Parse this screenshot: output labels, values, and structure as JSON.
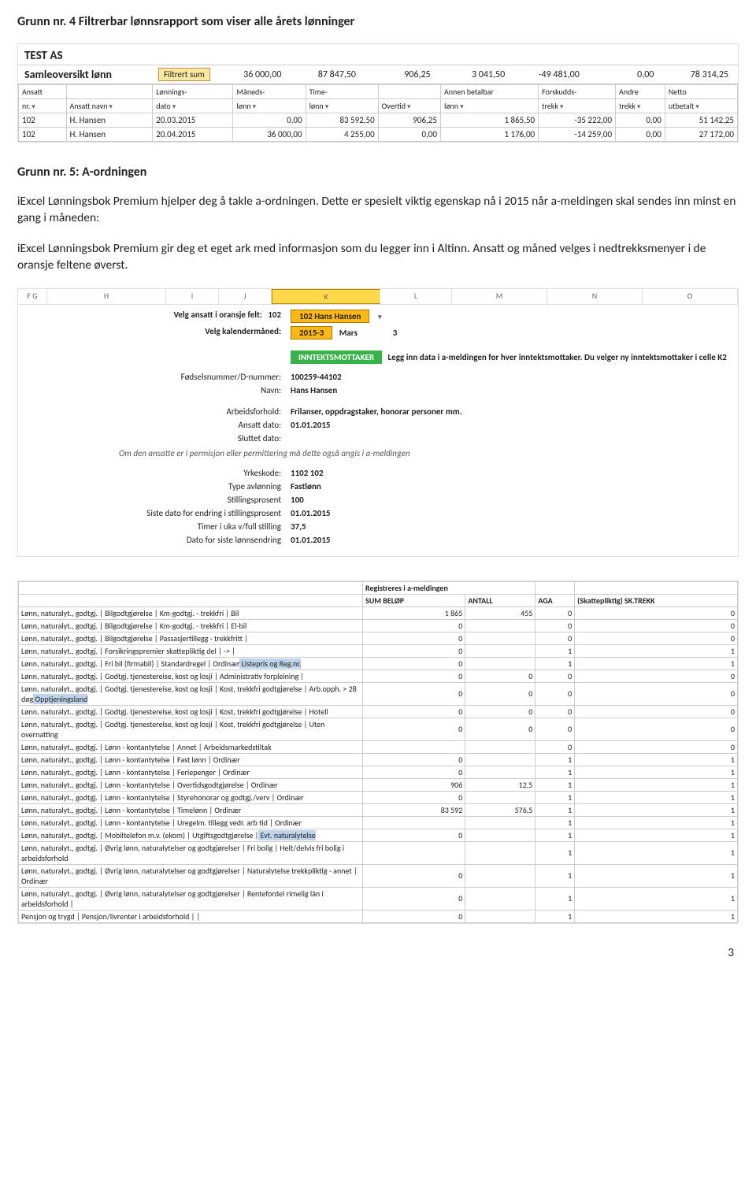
{
  "headings": {
    "title1": "Grunn nr. 4 Filtrerbar lønnsrapport som viser alle årets lønninger",
    "title2": "Grunn nr. 5: A-ordningen"
  },
  "prose": {
    "p1a": "iExcel Lønningsbok Premium hjelper deg å takle a-ordningen. Dette er spesielt viktig egenskap nå i 2015 når a-meldingen skal sendes inn minst en gang i måneden:",
    "p1b": "iExcel Lønningsbok Premium gir deg et eget ark med informasjon som du legger inn i Altinn. Ansatt og måned velges i nedtrekksmenyer i de oransje feltene øverst."
  },
  "block1": {
    "company": "TEST AS",
    "samle_label": "Samleoversikt lønn",
    "filtrert": "Filtrert sum",
    "sum": [
      "36 000,00",
      "87 847,50",
      "906,25",
      "3 041,50",
      "-49 481,00",
      "0,00",
      "78 314,25"
    ],
    "headers1": [
      "Ansatt",
      "",
      "Lønnings-",
      "Måneds-",
      "Time-",
      "",
      "Annen betalbar",
      "Forskudds-",
      "Andre",
      "Netto"
    ],
    "headers2": [
      "nr.",
      "Ansatt navn",
      "dato",
      "lønn",
      "lønn",
      "Overtid",
      "lønn",
      "trekk",
      "trekk",
      "utbetalt"
    ],
    "rows": [
      [
        "102",
        "H. Hansen",
        "20.03.2015",
        "0,00",
        "83 592,50",
        "906,25",
        "1 865,50",
        "-35 222,00",
        "0,00",
        "51 142,25"
      ],
      [
        "102",
        "H. Hansen",
        "20.04.2015",
        "36 000,00",
        "4 255,00",
        "0,00",
        "1 176,00",
        "-14 259,00",
        "0,00",
        "27 172,00"
      ]
    ]
  },
  "block2": {
    "cols": [
      "F G",
      "H",
      "I",
      "J",
      "K",
      "L",
      "M",
      "N",
      "O"
    ],
    "velg_ansatt_lab": "Velg ansatt i oransje felt:",
    "velg_ansatt_id": "102",
    "velg_ansatt_name": "102 Hans Hansen",
    "velg_mnd_lab": "Velg kalendermåned:",
    "velg_mnd_val": "2015-3",
    "velg_mnd_name": "Mars",
    "velg_mnd_num": "3",
    "inntektsmottaker": "INNTEKTSMOTTAKER",
    "inntekts_note": "Legg inn data i a-meldingen for hver inntektsmottaker. Du velger ny inntektsmottaker i celle K2",
    "rows_a": [
      [
        "Fødselsnummer/D-nummer:",
        "100259-44102"
      ],
      [
        "Navn:",
        "Hans Hansen"
      ]
    ],
    "rows_b": [
      [
        "Arbeidsforhold:",
        "Frilanser, oppdragstaker, honorar personer mm."
      ],
      [
        "Ansatt dato:",
        "01.01.2015"
      ],
      [
        "Sluttet dato:",
        ""
      ]
    ],
    "perm_note": "Om den ansatte er i  permisjon  eller  permittering  må dette også angis i a-meldingen",
    "rows_c": [
      [
        "Yrkeskode:",
        "1102 102"
      ],
      [
        "Type avlønning",
        "Fastlønn"
      ],
      [
        "Stillingsprosent",
        "100"
      ],
      [
        "Siste dato for endring i stillingsprosent",
        "01.01.2015"
      ],
      [
        "Timer i uka v/full stilling",
        "37,5"
      ],
      [
        "Dato for siste lønnsendring",
        "01.01.2015"
      ]
    ]
  },
  "block3": {
    "top1": "Registreres i a-meldingen",
    "top2_cols": [
      "SUM BELØP",
      "ANTALL",
      "AGA",
      "(Skattepliktig) SK.TREKK"
    ],
    "rows": [
      {
        "d": "Lønn, naturalyt., godtgj.  |  Bilgodtgjørelse  |  Km-godtgj. - trekkfri  |  Bil",
        "b": "1 865",
        "a": "455",
        "aga": "0",
        "sk": "0"
      },
      {
        "d": "Lønn, naturalyt., godtgj.  |  Bilgodtgjørelse  |  Km-godtgj. - trekkfri  |  El-bil",
        "b": "0",
        "a": "",
        "aga": "0",
        "sk": "0"
      },
      {
        "d": "Lønn, naturalyt., godtgj.  |  Bilgodtgjørelse  |  Passasjertillegg - trekkfritt  |",
        "b": "0",
        "a": "",
        "aga": "0",
        "sk": "0"
      },
      {
        "d": "Lønn, naturalyt., godtgj.  |  Forsikringspremier skattepliktig del  |  ->  |",
        "b": "0",
        "a": "",
        "aga": "1",
        "sk": "1"
      },
      {
        "d": "Lønn, naturalyt., godtgj.  |  Fri bil (firmabil)  |  Standardregel  |  Ordinær",
        "b": "0",
        "a": "",
        "aga": "1",
        "sk": "1",
        "note": "Listepris og Reg.nr."
      },
      {
        "d": "Lønn, naturalyt., godtgj.  |  Godtgj. tjenestereise, kost og losji  |  Administrativ forpleining  |",
        "b": "0",
        "a": "0",
        "aga": "0",
        "sk": "0"
      },
      {
        "d": "Lønn, naturalyt., godtgj.  |  Godtgj. tjenestereise, kost og losji  |  Kost, trekkfri godtgjørelse  |  Arb.opph. > 28 døg",
        "b": "0",
        "a": "0",
        "aga": "0",
        "sk": "0",
        "note": "Opptjeningsland"
      },
      {
        "d": "Lønn, naturalyt., godtgj.  |  Godtgj. tjenestereise, kost og losji  |  Kost, trekkfri godtgjørelse  |  Hotell",
        "b": "0",
        "a": "0",
        "aga": "0",
        "sk": "0"
      },
      {
        "d": "Lønn, naturalyt., godtgj.  |  Godtgj. tjenestereise, kost og losji  |  Kost, trekkfri godtgjørelse  |  Uten overnatting",
        "b": "0",
        "a": "0",
        "aga": "0",
        "sk": "0"
      },
      {
        "d": "Lønn, naturalyt., godtgj.  |  Lønn - kontantytelse  |  Annet  |  Arbeidsmarkedstiltak",
        "b": "",
        "a": "",
        "aga": "0",
        "sk": "0"
      },
      {
        "d": "Lønn, naturalyt., godtgj.  |  Lønn - kontantytelse  |  Fast lønn  |  Ordinær",
        "b": "0",
        "a": "",
        "aga": "1",
        "sk": "1"
      },
      {
        "d": "Lønn, naturalyt., godtgj.  |  Lønn - kontantytelse  |  Feriepenger  |  Ordinær",
        "b": "0",
        "a": "",
        "aga": "1",
        "sk": "1"
      },
      {
        "d": "Lønn, naturalyt., godtgj.  |  Lønn - kontantytelse  |  Overtidsgodtgjørelse  |  Ordinær",
        "b": "906",
        "a": "12,5",
        "aga": "1",
        "sk": "1"
      },
      {
        "d": "Lønn, naturalyt., godtgj.  |  Lønn - kontantytelse  |  Styrehonorar og godtgj./verv  |  Ordinær",
        "b": "0",
        "a": "",
        "aga": "1",
        "sk": "1"
      },
      {
        "d": "Lønn, naturalyt., godtgj.  |  Lønn - kontantytelse  |  Timelønn  |  Ordinær",
        "b": "83 592",
        "a": "576,5",
        "aga": "1",
        "sk": "1"
      },
      {
        "d": "Lønn, naturalyt., godtgj.  |  Lønn - kontantytelse  |  Uregelm. tillegg vedr. arb tid  |  Ordinær",
        "b": "",
        "a": "",
        "aga": "1",
        "sk": "1"
      },
      {
        "d": "Lønn, naturalyt., godtgj.  |  Mobiltelefon m.v. (ekom)  |  Utgiftsgodtgjørelse  |",
        "b": "0",
        "a": "",
        "aga": "1",
        "sk": "1",
        "note": "Evt. naturalytelse"
      },
      {
        "d": "Lønn, naturalyt., godtgj.  |  Øvrig lønn, naturalytelser og godtgjørelser  |  Fri bolig  |  Helt/delvis fri bolig i arbeidsforhold",
        "b": "",
        "a": "",
        "aga": "1",
        "sk": "1"
      },
      {
        "d": "Lønn, naturalyt., godtgj.  |  Øvrig lønn, naturalytelser og godtgjørelser  |  Naturalytelse trekkpliktig - annet  |  Ordinær",
        "b": "0",
        "a": "",
        "aga": "1",
        "sk": "1"
      },
      {
        "d": "Lønn, naturalyt., godtgj.  |  Øvrig lønn, naturalytelser og godtgjørelser  |  Rentefordel rimelig lån i arbeidsforhold  |",
        "b": "0",
        "a": "",
        "aga": "1",
        "sk": "1"
      },
      {
        "d": "Pensjon og trygd  |  Pensjon/livrenter i arbeidsforhold  |   |",
        "b": "0",
        "a": "",
        "aga": "1",
        "sk": "1"
      }
    ]
  },
  "pagenum": "3"
}
